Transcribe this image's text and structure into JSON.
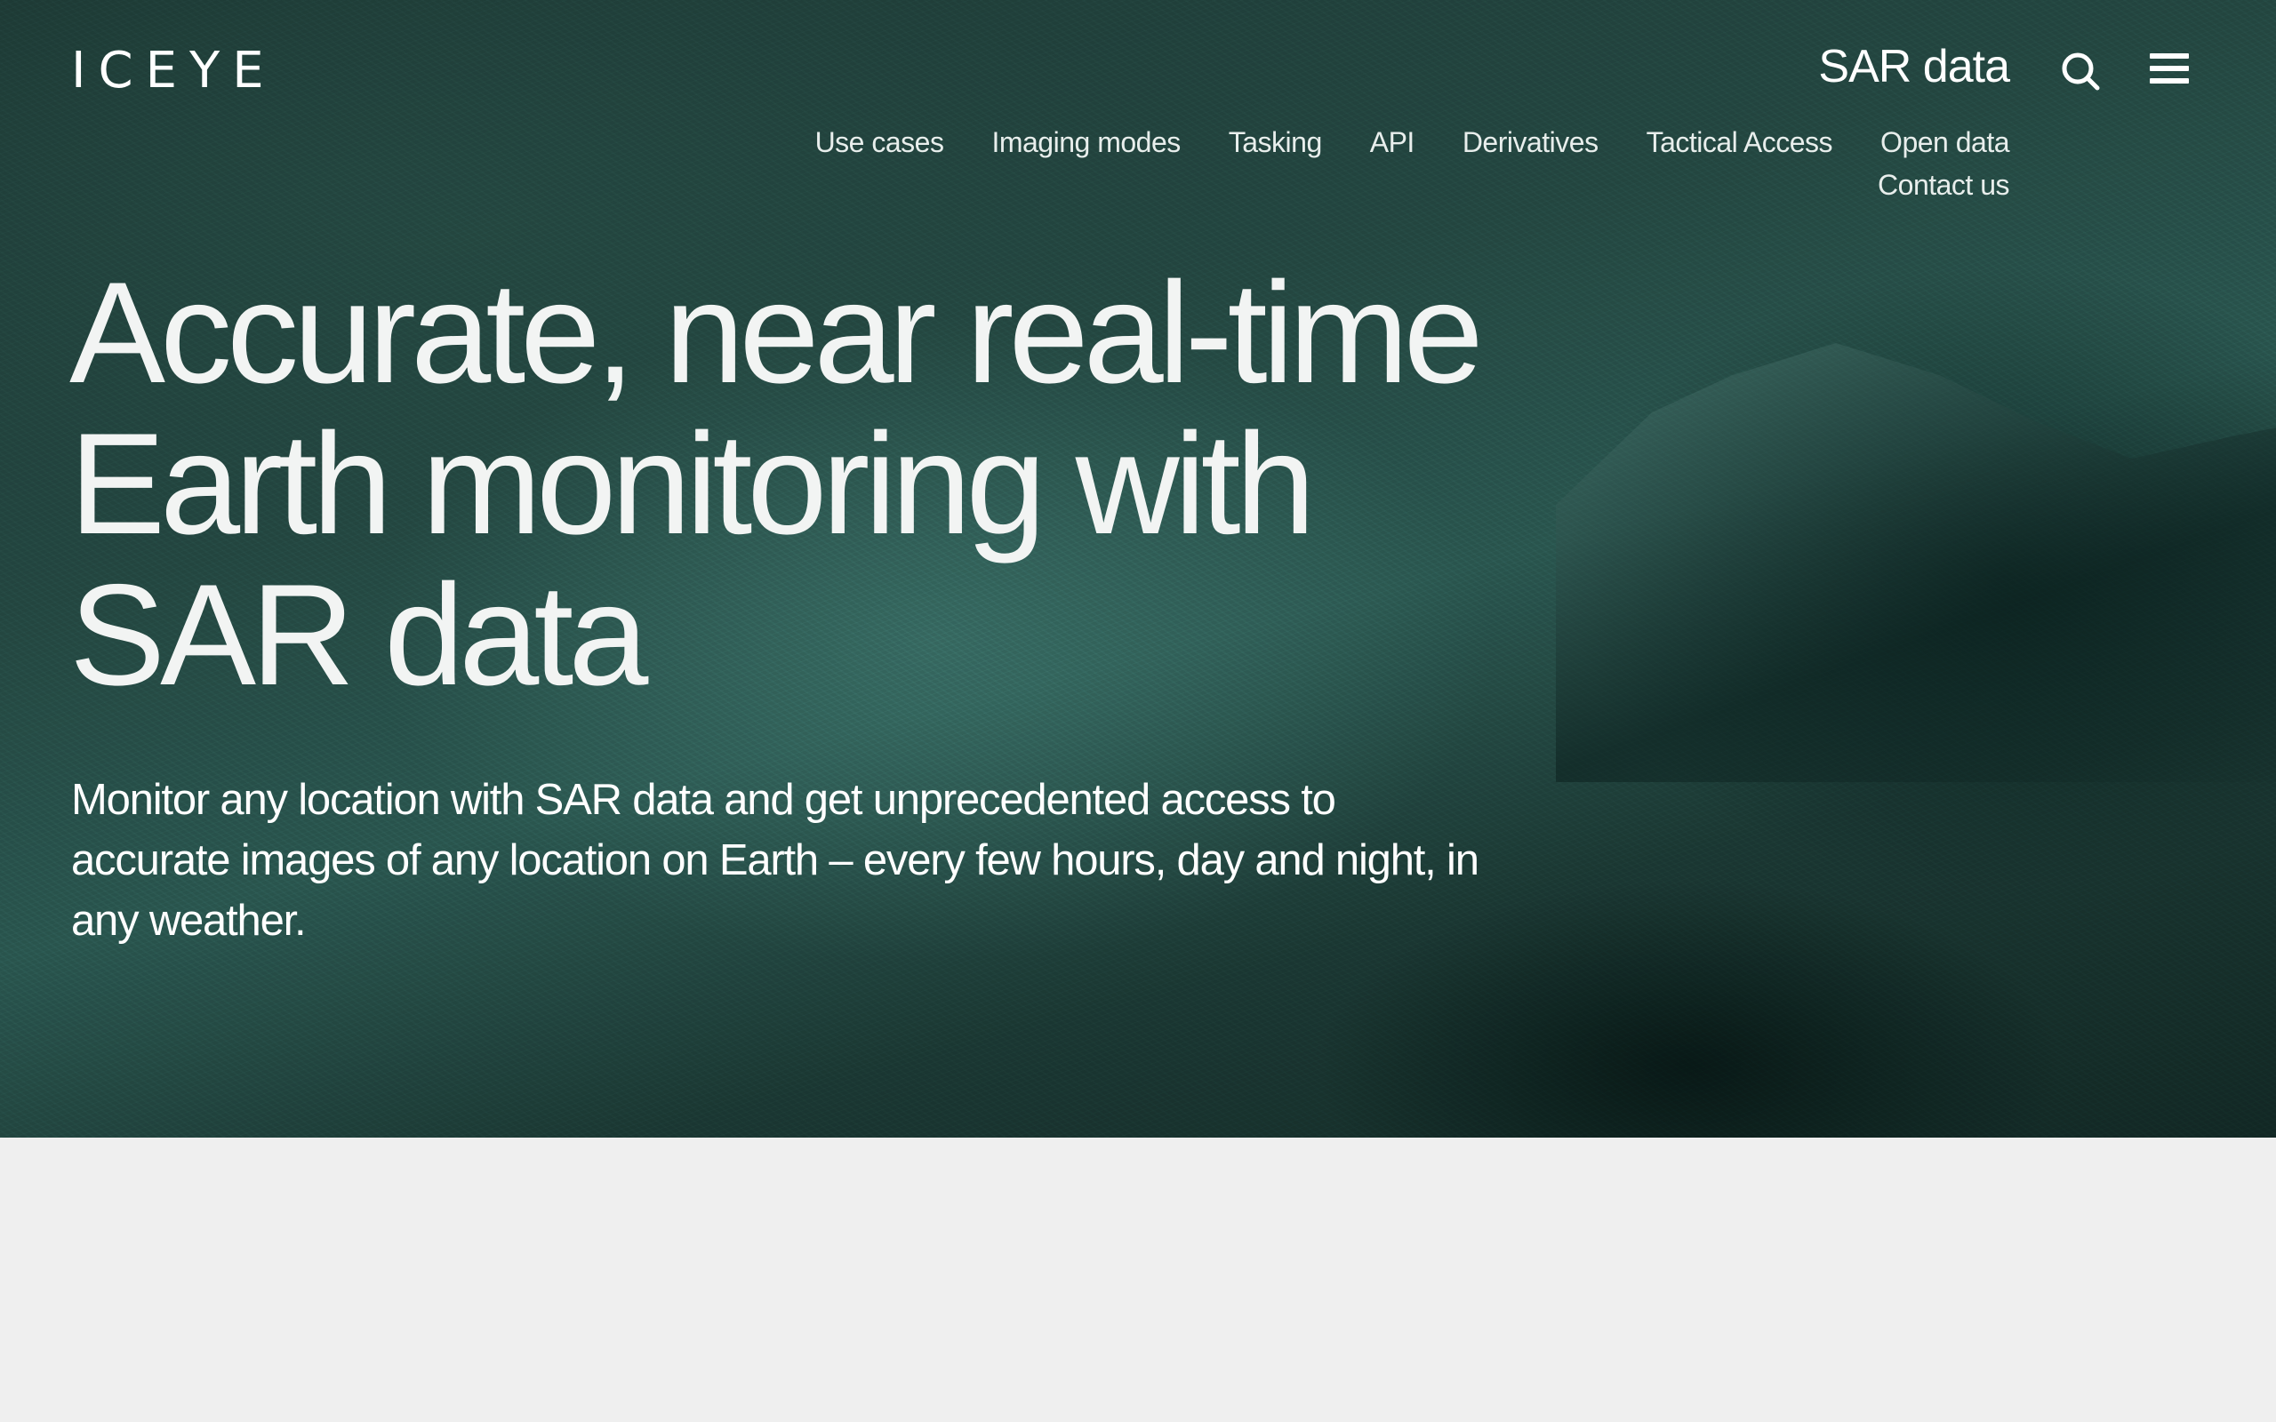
{
  "header": {
    "logo_text": "ICEYE",
    "section_title": "SAR data",
    "icons": {
      "search": "search-icon",
      "menu": "hamburger-menu-icon"
    }
  },
  "subnav": {
    "items": [
      "Use cases",
      "Imaging modes",
      "Tasking",
      "API",
      "Derivatives",
      "Tactical Access",
      "Open data",
      "Contact us"
    ]
  },
  "hero": {
    "headline": "Accurate, near real-time Earth monitoring with SAR data",
    "lede": "Monitor any location with SAR data and get unprecedented access to accurate images of any location on Earth – every few hours, day and night, in any weather."
  },
  "colors": {
    "hero_tint": "#254a44",
    "text": "#ffffff",
    "page_background": "#efefef"
  }
}
